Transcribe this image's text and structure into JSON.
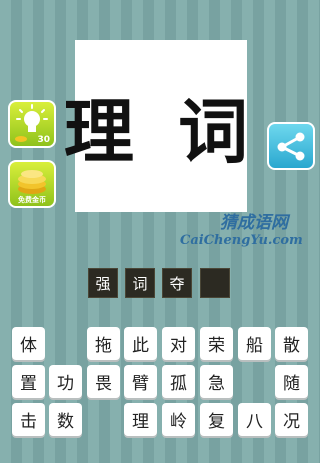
{
  "puzzle": {
    "text": "理 词"
  },
  "hint_button": {
    "count": "30"
  },
  "coin_button": {
    "label": "免费金币"
  },
  "watermark": {
    "cn": "猜成语网",
    "en": "CaiChengYu.com"
  },
  "answer_slots": [
    "强",
    "词",
    "夺",
    ""
  ],
  "tiles": [
    [
      "体",
      "",
      "拖",
      "此",
      "对",
      "荣",
      "船",
      "散"
    ],
    [
      "置",
      "功",
      "畏",
      "臂",
      "孤",
      "急",
      "",
      "随"
    ],
    [
      "击",
      "数",
      "",
      "理",
      "岭",
      "复",
      "八",
      "况"
    ]
  ]
}
